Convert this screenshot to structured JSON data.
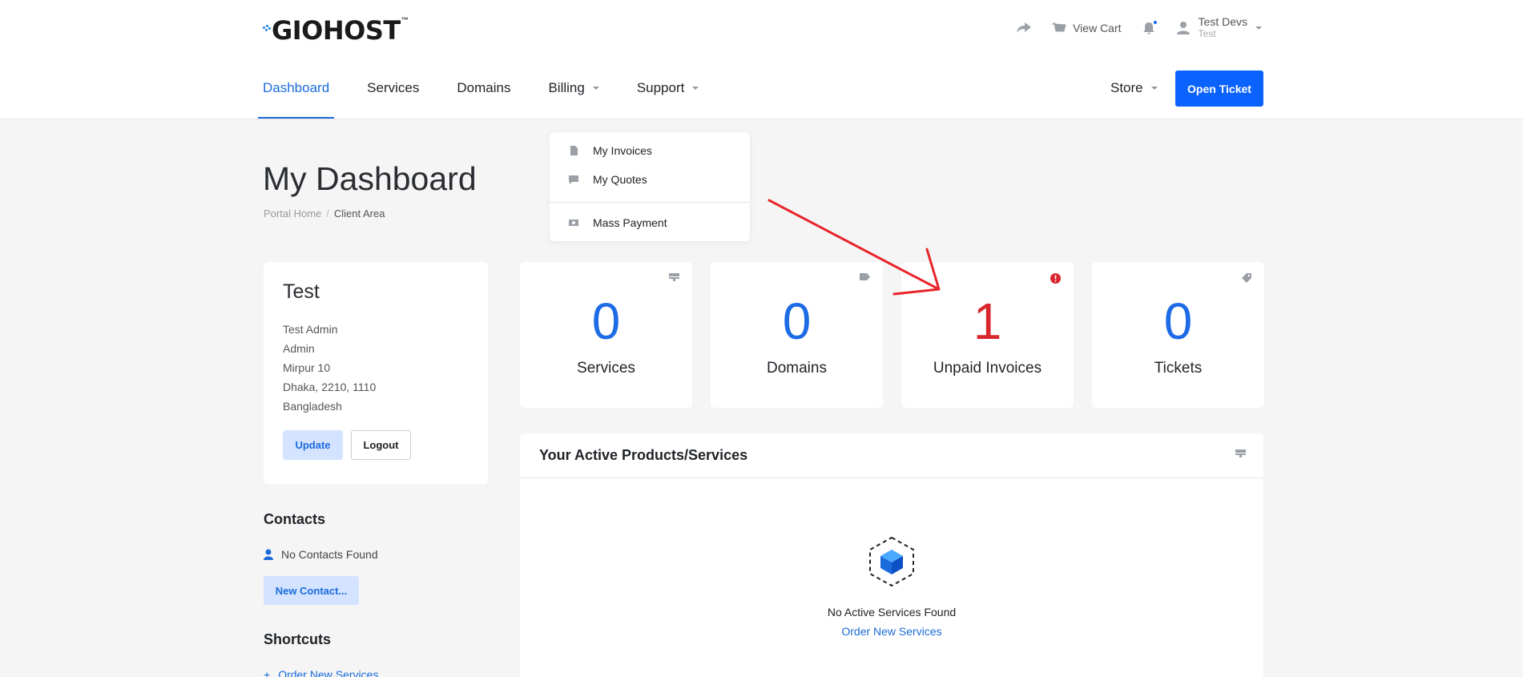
{
  "brand": {
    "name": "GIOHOST",
    "tm": "™",
    "accent": "#0a62ff"
  },
  "topbar": {
    "view_cart": "View Cart",
    "user_name": "Test Devs",
    "user_sub": "Test"
  },
  "nav": {
    "items": [
      {
        "label": "Dashboard",
        "active": true
      },
      {
        "label": "Services"
      },
      {
        "label": "Domains"
      },
      {
        "label": "Billing"
      },
      {
        "label": "Support"
      }
    ],
    "store": "Store",
    "open_ticket": "Open Ticket"
  },
  "billing_menu": {
    "items": [
      "My Invoices",
      "My Quotes",
      "Mass Payment"
    ]
  },
  "page": {
    "title": "My Dashboard",
    "breadcrumb": [
      "Portal Home",
      "/",
      "Client Area"
    ]
  },
  "client": {
    "name": "Test",
    "address": [
      "Test Admin",
      "Admin",
      "Mirpur 10",
      "Dhaka, 2210, 1110",
      "Bangladesh"
    ],
    "update": "Update",
    "logout": "Logout"
  },
  "contacts": {
    "title": "Contacts",
    "empty": "No Contacts Found",
    "new": "New Contact..."
  },
  "shortcuts": {
    "title": "Shortcuts",
    "first": "Order New Services"
  },
  "stats": [
    {
      "value": "0",
      "label": "Services"
    },
    {
      "value": "0",
      "label": "Domains"
    },
    {
      "value": "1",
      "label": "Unpaid Invoices"
    },
    {
      "value": "0",
      "label": "Tickets"
    }
  ],
  "products": {
    "title": "Your Active Products/Services",
    "empty": "No Active Services Found",
    "order": "Order New Services"
  }
}
